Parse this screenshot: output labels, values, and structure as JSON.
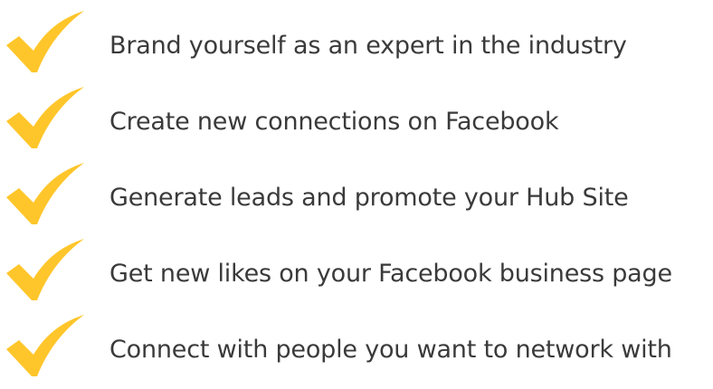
{
  "accent_color": "#FFC62B",
  "icon": "checkmark-icon",
  "items": [
    {
      "label": "Brand yourself as an expert in the industry"
    },
    {
      "label": "Create new connections on Facebook"
    },
    {
      "label": "Generate leads and promote your Hub Site"
    },
    {
      "label": "Get new likes on your Facebook business page"
    },
    {
      "label": "Connect with people you want to network with"
    }
  ]
}
